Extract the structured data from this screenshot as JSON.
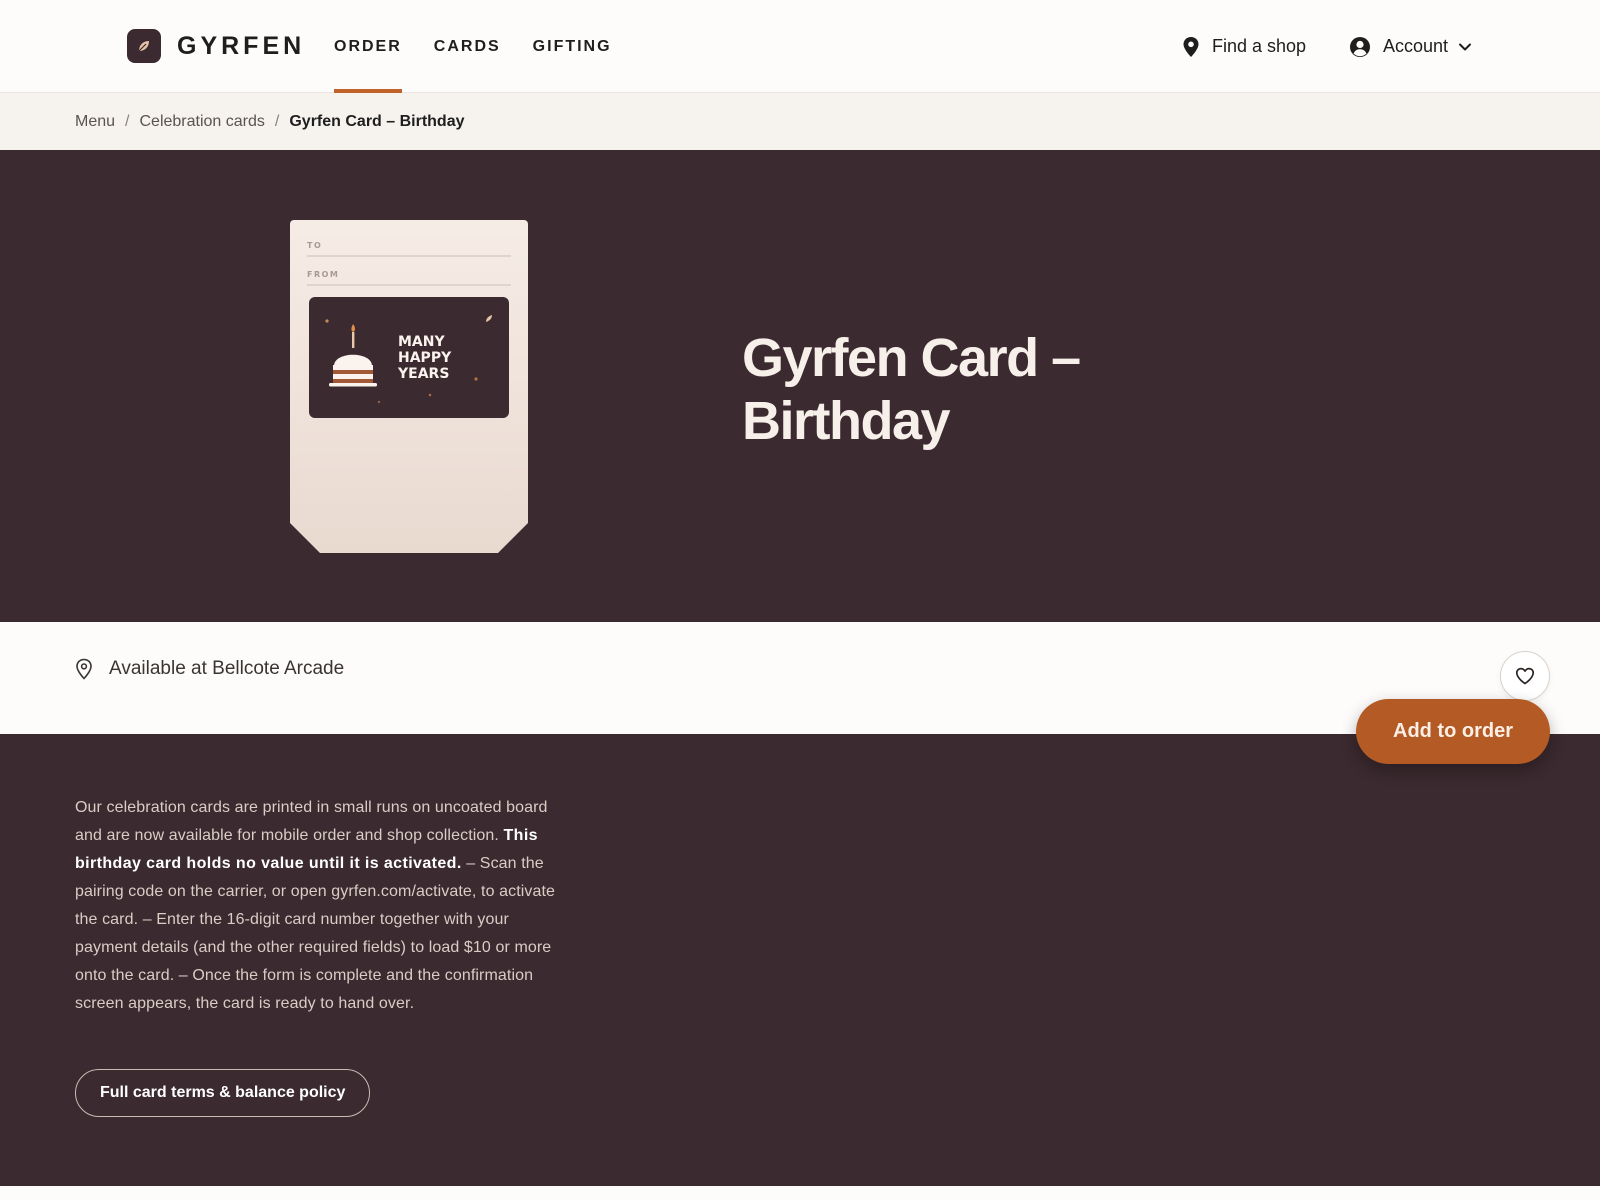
{
  "header": {
    "brand": "GYRFEN",
    "nav": [
      {
        "label": "ORDER",
        "active": true
      },
      {
        "label": "CARDS",
        "active": false
      },
      {
        "label": "GIFTING",
        "active": false
      }
    ],
    "find_shop": "Find a shop",
    "account": "Account"
  },
  "breadcrumb": {
    "items": [
      "Menu",
      "Celebration cards"
    ],
    "current": "Gyrfen Card – Birthday"
  },
  "product": {
    "title": "Gyrfen Card – Birthday",
    "card": {
      "to_label": "TO",
      "from_label": "FROM",
      "greeting_line1": "MANY",
      "greeting_line2": "HAPPY",
      "greeting_line3": "YEARS"
    }
  },
  "availability": {
    "text": "Available at Bellcote Arcade"
  },
  "actions": {
    "add_to_order": "Add to order",
    "favorite_icon": "heart-icon"
  },
  "details": {
    "intro": "Our celebration cards are printed in small runs on uncoated board and are now available for mobile order and shop collection. ",
    "emphasis": "This birthday card holds no value until it is activated.",
    "body": " – Scan the pairing code on the carrier, or open gyrfen.com/activate, to activate the card. – Enter the 16-digit card number together with your payment details (and the other required fields) to load $10 or more onto the card. – Once the form is complete and the confirmation screen appears, the card is ready to hand over.",
    "terms_button": "Full card terms & balance policy"
  },
  "colors": {
    "brand_dark": "#3b2a2f",
    "accent": "#b45a24",
    "nav_underline": "#c1622a"
  }
}
